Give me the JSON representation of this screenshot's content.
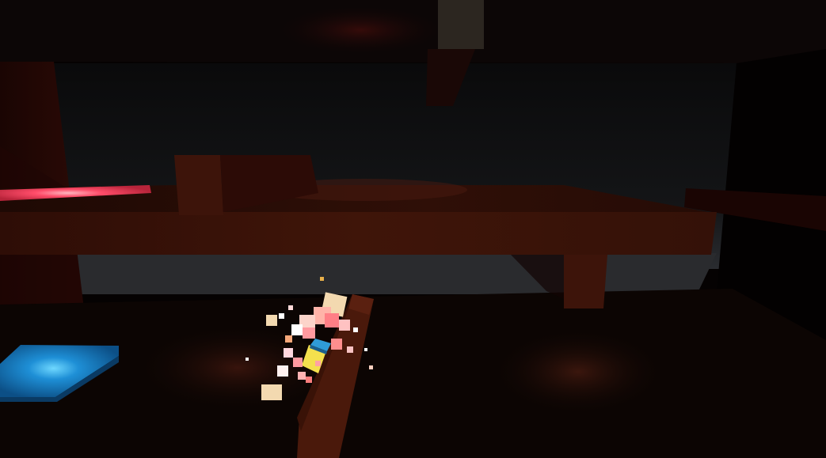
{
  "scene": {
    "kind": "3d-voxel-game-view",
    "hud_text": [],
    "colors": {
      "background": "#050202",
      "floor": "#0c0503",
      "ceiling": "#0c0606",
      "table_top": "#2b0d05",
      "table_front": "#3c1308",
      "table_leg": "#3d140a",
      "pillar": "#4a190b",
      "red_pad": "#ff4d6a",
      "blue_pad": "#1e8fd6",
      "back_wall": "#101113",
      "dim_band": "#2a2b2e",
      "ceiling_block": "#2c2620",
      "player_body": "#f4e04d",
      "player_cap": "#2f9bd7",
      "particle_pink": "#ff9aa0",
      "particle_cream": "#f3d9b0"
    }
  }
}
